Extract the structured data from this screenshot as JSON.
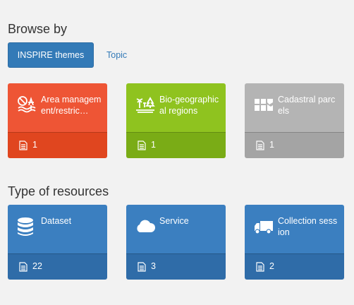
{
  "browse": {
    "title": "Browse by",
    "tabs": [
      "INSPIRE themes",
      "Topic"
    ],
    "cards": [
      {
        "label": "Area management/restric…",
        "count": "1",
        "icon": "protected-area-icon",
        "color_top": "#ee5535",
        "color_bottom": "#e0461f"
      },
      {
        "label": "Bio-geographical regions",
        "count": "1",
        "icon": "biogeographic-icon",
        "color_top": "#8fc31f",
        "color_bottom": "#7aac16"
      },
      {
        "label": "Cadastral parcels",
        "count": "1",
        "icon": "cadastral-icon",
        "color_top": "#b4b4b4",
        "color_bottom": "#a4a4a4"
      }
    ]
  },
  "resources": {
    "title": "Type of resources",
    "cards": [
      {
        "label": "Dataset",
        "count": "22",
        "icon": "database-icon",
        "color_top": "#3b7fc0",
        "color_bottom": "#2f6ca8"
      },
      {
        "label": "Service",
        "count": "3",
        "icon": "cloud-icon",
        "color_top": "#3b7fc0",
        "color_bottom": "#2f6ca8"
      },
      {
        "label": "Collection session",
        "count": "2",
        "icon": "truck-icon",
        "color_top": "#3b7fc0",
        "color_bottom": "#2f6ca8"
      }
    ]
  }
}
